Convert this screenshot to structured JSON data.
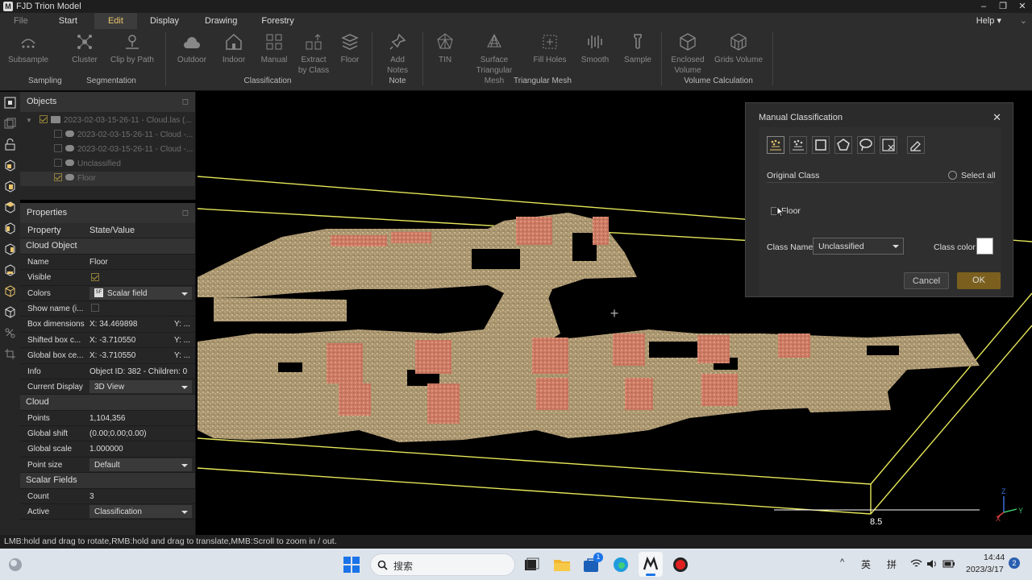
{
  "app": {
    "title": "FJD Trion Model",
    "logo": "M"
  },
  "window_controls": {
    "minimize": "–",
    "maximize": "❐",
    "close": "✕"
  },
  "menu": {
    "items": [
      "File",
      "Start",
      "Edit",
      "Display",
      "Drawing",
      "Forestry"
    ],
    "active": "Edit",
    "help": "Help ▾",
    "collapse": "⌄"
  },
  "ribbon": {
    "buttons": [
      {
        "label": "Subsample",
        "icon": "subsample-icon"
      },
      {
        "label": "Cluster",
        "icon": "cluster-icon"
      },
      {
        "label": "Clip by Path",
        "icon": "clip-path-icon"
      },
      {
        "label": "Outdoor",
        "icon": "outdoor-icon"
      },
      {
        "label": "Indoor",
        "icon": "indoor-icon"
      },
      {
        "label": "Manual",
        "icon": "manual-icon"
      },
      {
        "label": "Extract by Class",
        "icon": "extract-icon"
      },
      {
        "label": "Floor",
        "icon": "floor-icon"
      },
      {
        "label": "Add Notes",
        "icon": "add-notes-icon"
      },
      {
        "label": "TIN",
        "icon": "tin-icon"
      },
      {
        "label": "Surface Triangular Mesh",
        "icon": "surface-mesh-icon"
      },
      {
        "label": "Fill Holes",
        "icon": "fill-holes-icon"
      },
      {
        "label": "Smooth",
        "icon": "smooth-icon"
      },
      {
        "label": "Sample",
        "icon": "sample-icon"
      },
      {
        "label": "Enclosed Volume",
        "icon": "enclosed-volume-icon"
      },
      {
        "label": "Grids Volume",
        "icon": "grids-volume-icon"
      }
    ],
    "groups": [
      "Sampling",
      "Segmentation",
      "Classification",
      "Note",
      "Triangular Mesh",
      "Volume Calculation"
    ]
  },
  "objects": {
    "title": "Objects",
    "pin": "◻",
    "tree": [
      {
        "label": "2023-02-03-15-26-11 - Cloud.las (...",
        "checked": true
      },
      {
        "label": "2023-02-03-15-26-11 - Cloud -...",
        "checked": false
      },
      {
        "label": "2023-02-03-15-26-11 - Cloud -...",
        "checked": false
      },
      {
        "label": "Unclassified",
        "checked": false
      },
      {
        "label": "Floor",
        "checked": true
      }
    ]
  },
  "properties": {
    "title": "Properties",
    "pin": "◻",
    "col_property": "Property",
    "col_value": "State/Value",
    "sec_cloud_object": "Cloud Object",
    "name_k": "Name",
    "name_v": "Floor",
    "visible_k": "Visible",
    "colors_k": "Colors",
    "colors_v": "Scalar field",
    "colors_icon": "SF",
    "showname_k": "Show name (i...",
    "boxdim_k": "Box dimensions",
    "boxdim_v": "X: 34.469898",
    "boxdim_y": "Y: ...",
    "shifted_k": "Shifted box c...",
    "shifted_v": "X: -3.710550",
    "shifted_y": "Y: ...",
    "global_k": "Global box ce...",
    "global_v": "X: -3.710550",
    "global_y": "Y: ...",
    "info_k": "Info",
    "info_v": "Object ID: 382 - Children: 0",
    "curdisp_k": "Current Display",
    "curdisp_v": "3D View",
    "sec_cloud": "Cloud",
    "points_k": "Points",
    "points_v": "1,104,356",
    "gshift_k": "Global shift",
    "gshift_v": "(0.00;0.00;0.00)",
    "gscale_k": "Global scale",
    "gscale_v": "1.000000",
    "psize_k": "Point size",
    "psize_v": "Default",
    "sec_scalar": "Scalar Fields",
    "count_k": "Count",
    "count_v": "3",
    "active_k": "Active",
    "active_v": "Classification"
  },
  "viewport": {
    "axis_value": "8.5",
    "axis_z": "Z",
    "axis_y": "Y",
    "axis_x": "X",
    "crosshair": "+"
  },
  "dialog": {
    "title": "Manual Classification",
    "close": "✕",
    "original_class": "Original Class",
    "select_all": "Select all",
    "floor": "Floor",
    "class_name_label": "Class Name",
    "class_name_value": "Unclassified",
    "class_color_label": "Class color",
    "class_color": "#ffffff",
    "cancel": "Cancel",
    "ok": "OK"
  },
  "status": "LMB:hold and drag to rotate,RMB:hold and drag to translate,MMB:Scroll to zoom in / out.",
  "taskbar": {
    "search_placeholder": "搜索",
    "ime_lang": "英",
    "ime_mode": "拼",
    "time": "14:44",
    "date": "2023/3/17",
    "notification_count": "2",
    "store_badge": "1",
    "chevron": "^"
  },
  "colors": {
    "accent": "#e9c46a",
    "ok_button": "#7a5f1e",
    "points_beige": "#c9b48a",
    "points_salmon": "#d98870",
    "yellow_line": "#e6e65a"
  }
}
